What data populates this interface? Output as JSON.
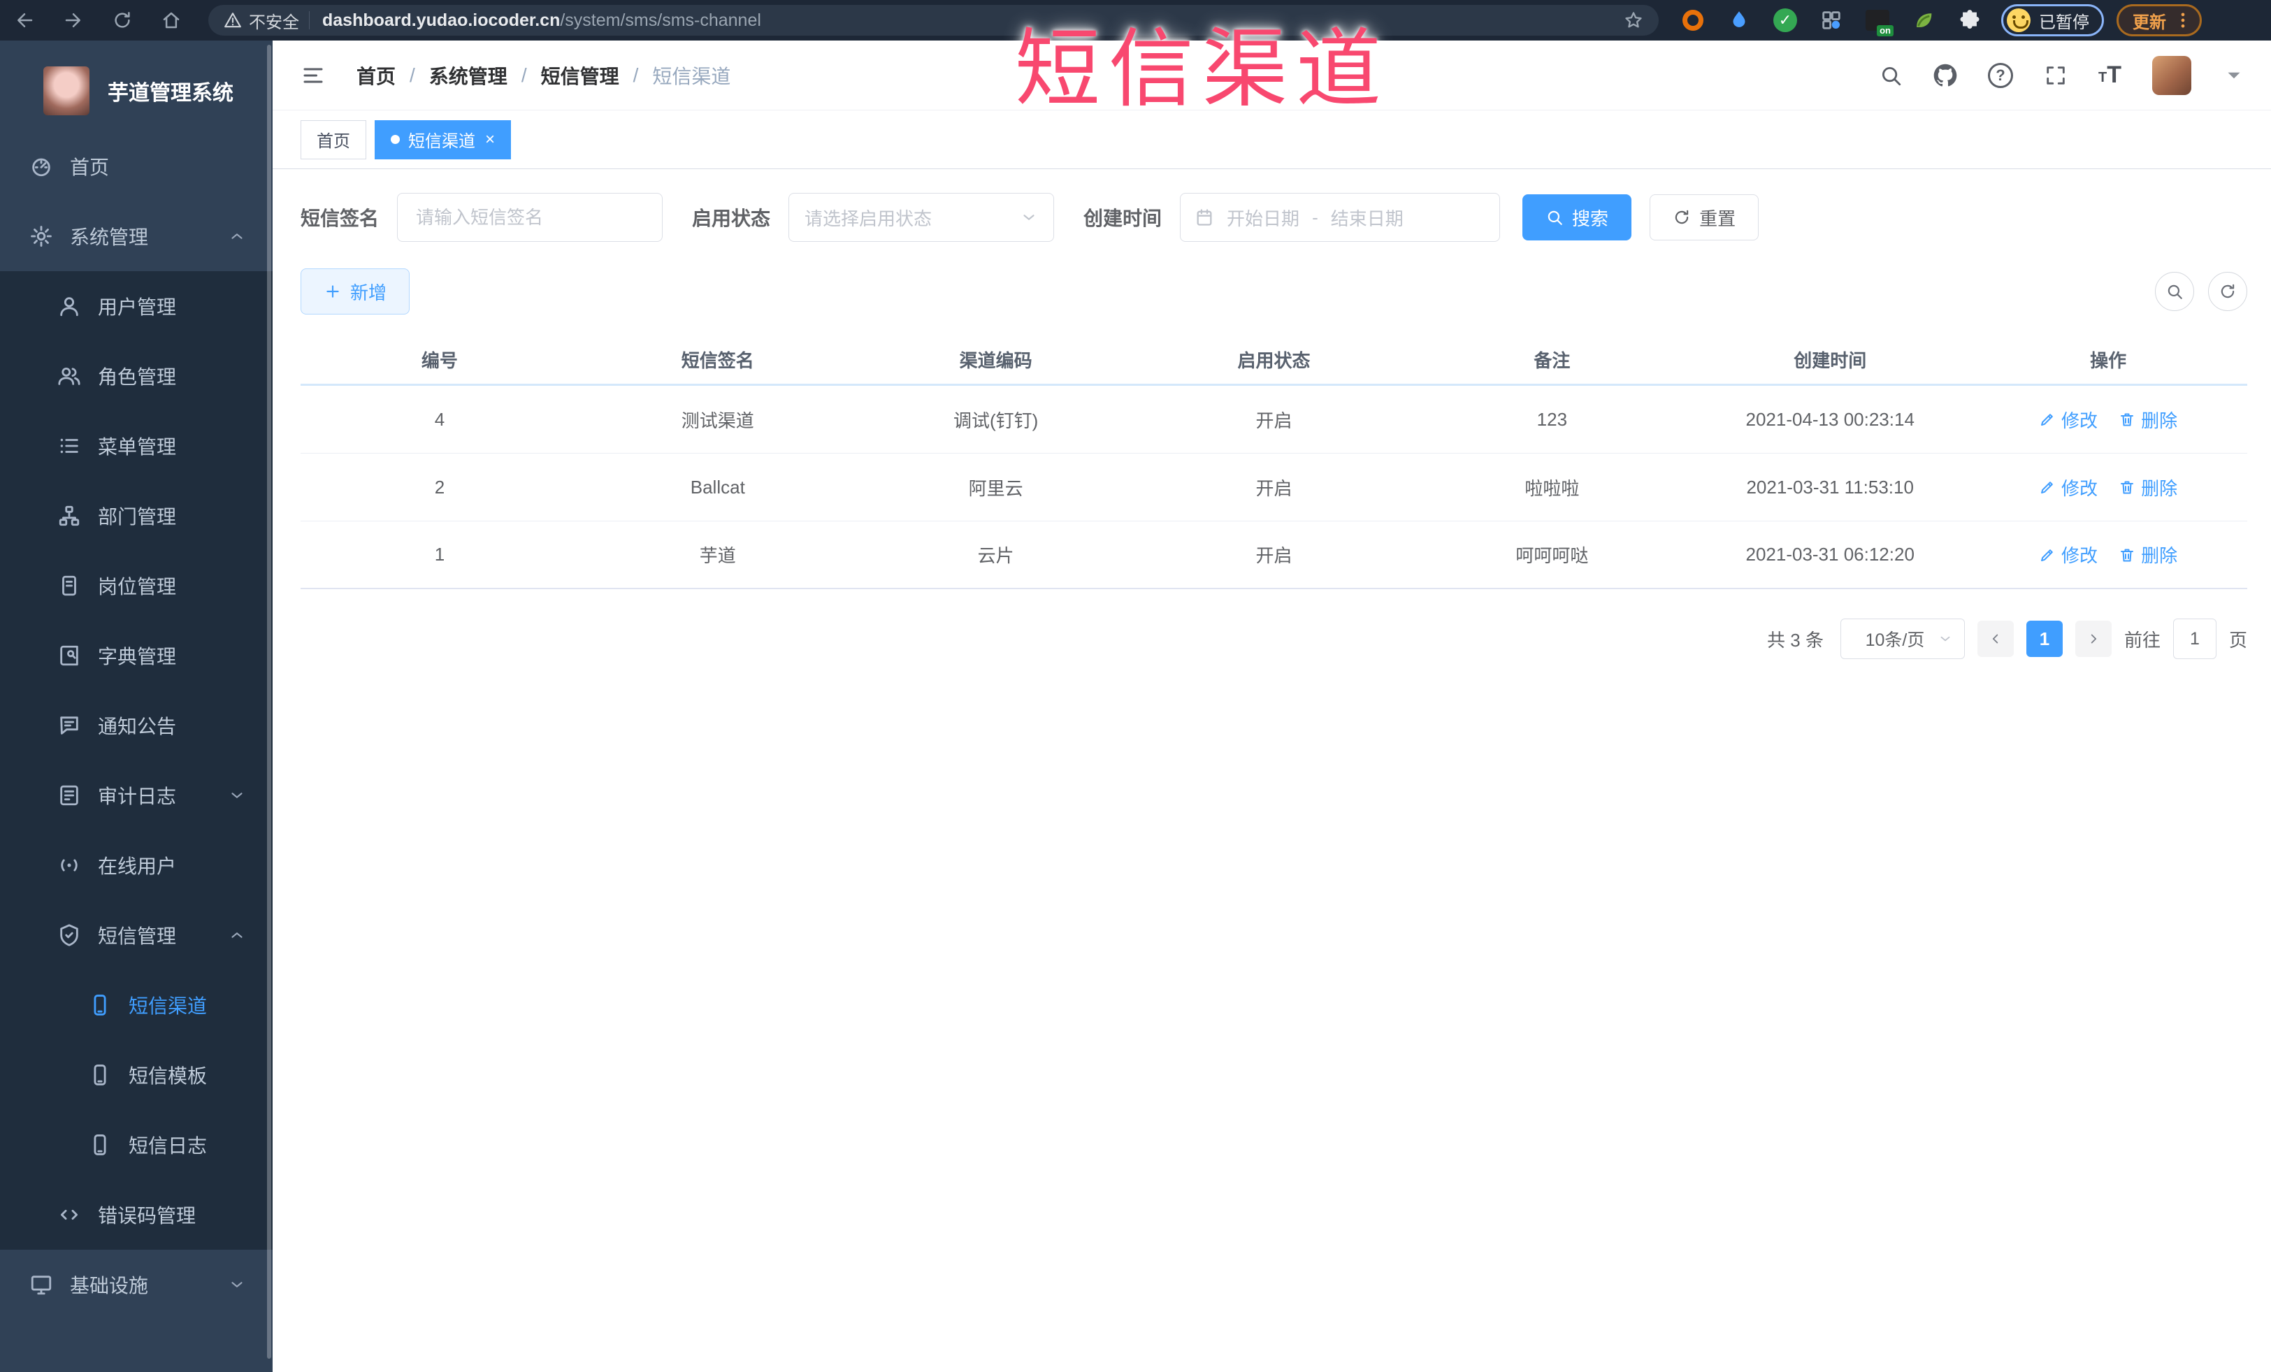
{
  "browser": {
    "security_label": "不安全",
    "url_domain": "dashboard.yudao.iocoder.cn",
    "url_path": "/system/sms/sms-channel",
    "on_badge": "on",
    "profile_status": "已暂停",
    "update_button": "更新"
  },
  "overlay_title": "短信渠道",
  "icons": {
    "check": "✓",
    "close": "×",
    "slash": "/",
    "question": "?",
    "t_large": "T",
    "t_small": "T"
  },
  "sidebar": {
    "app_title": "芋道管理系统",
    "items": [
      {
        "label": "首页"
      },
      {
        "label": "系统管理"
      },
      {
        "label": "用户管理"
      },
      {
        "label": "角色管理"
      },
      {
        "label": "菜单管理"
      },
      {
        "label": "部门管理"
      },
      {
        "label": "岗位管理"
      },
      {
        "label": "字典管理"
      },
      {
        "label": "通知公告"
      },
      {
        "label": "审计日志"
      },
      {
        "label": "在线用户"
      },
      {
        "label": "短信管理"
      },
      {
        "label": "短信渠道"
      },
      {
        "label": "短信模板"
      },
      {
        "label": "短信日志"
      },
      {
        "label": "错误码管理"
      },
      {
        "label": "基础设施"
      }
    ]
  },
  "breadcrumb": {
    "items": [
      "首页",
      "系统管理",
      "短信管理",
      "短信渠道"
    ]
  },
  "tabs": [
    {
      "label": "首页"
    },
    {
      "label": "短信渠道"
    }
  ],
  "filters": {
    "signature_label": "短信签名",
    "signature_placeholder": "请输入短信签名",
    "status_label": "启用状态",
    "status_placeholder": "请选择启用状态",
    "time_label": "创建时间",
    "date_start_placeholder": "开始日期",
    "date_separator": "-",
    "date_end_placeholder": "结束日期",
    "search_button": "搜索",
    "reset_button": "重置"
  },
  "toolbar": {
    "add_button": "新增"
  },
  "table": {
    "columns": [
      "编号",
      "短信签名",
      "渠道编码",
      "启用状态",
      "备注",
      "创建时间",
      "操作"
    ],
    "actions": {
      "edit": "修改",
      "delete": "删除"
    },
    "rows": [
      {
        "no": "4",
        "signature": "测试渠道",
        "channel": "调试(钉钉)",
        "status": "开启",
        "remark": "123",
        "time": "2021-04-13 00:23:14"
      },
      {
        "no": "2",
        "signature": "Ballcat",
        "channel": "阿里云",
        "status": "开启",
        "remark": "啦啦啦",
        "time": "2021-03-31 11:53:10"
      },
      {
        "no": "1",
        "signature": "芋道",
        "channel": "云片",
        "status": "开启",
        "remark": "呵呵呵哒",
        "time": "2021-03-31 06:12:20"
      }
    ]
  },
  "pagination": {
    "total": "共 3 条",
    "page_size": "10条/页",
    "current_page": "1",
    "goto_label": "前往",
    "goto_value": "1",
    "page_label": "页"
  },
  "colors": {
    "accent": "#409EFF",
    "overlay": "#f8486f",
    "sidebar_bg": "#304156",
    "submenu_bg": "#1f2d3d"
  }
}
